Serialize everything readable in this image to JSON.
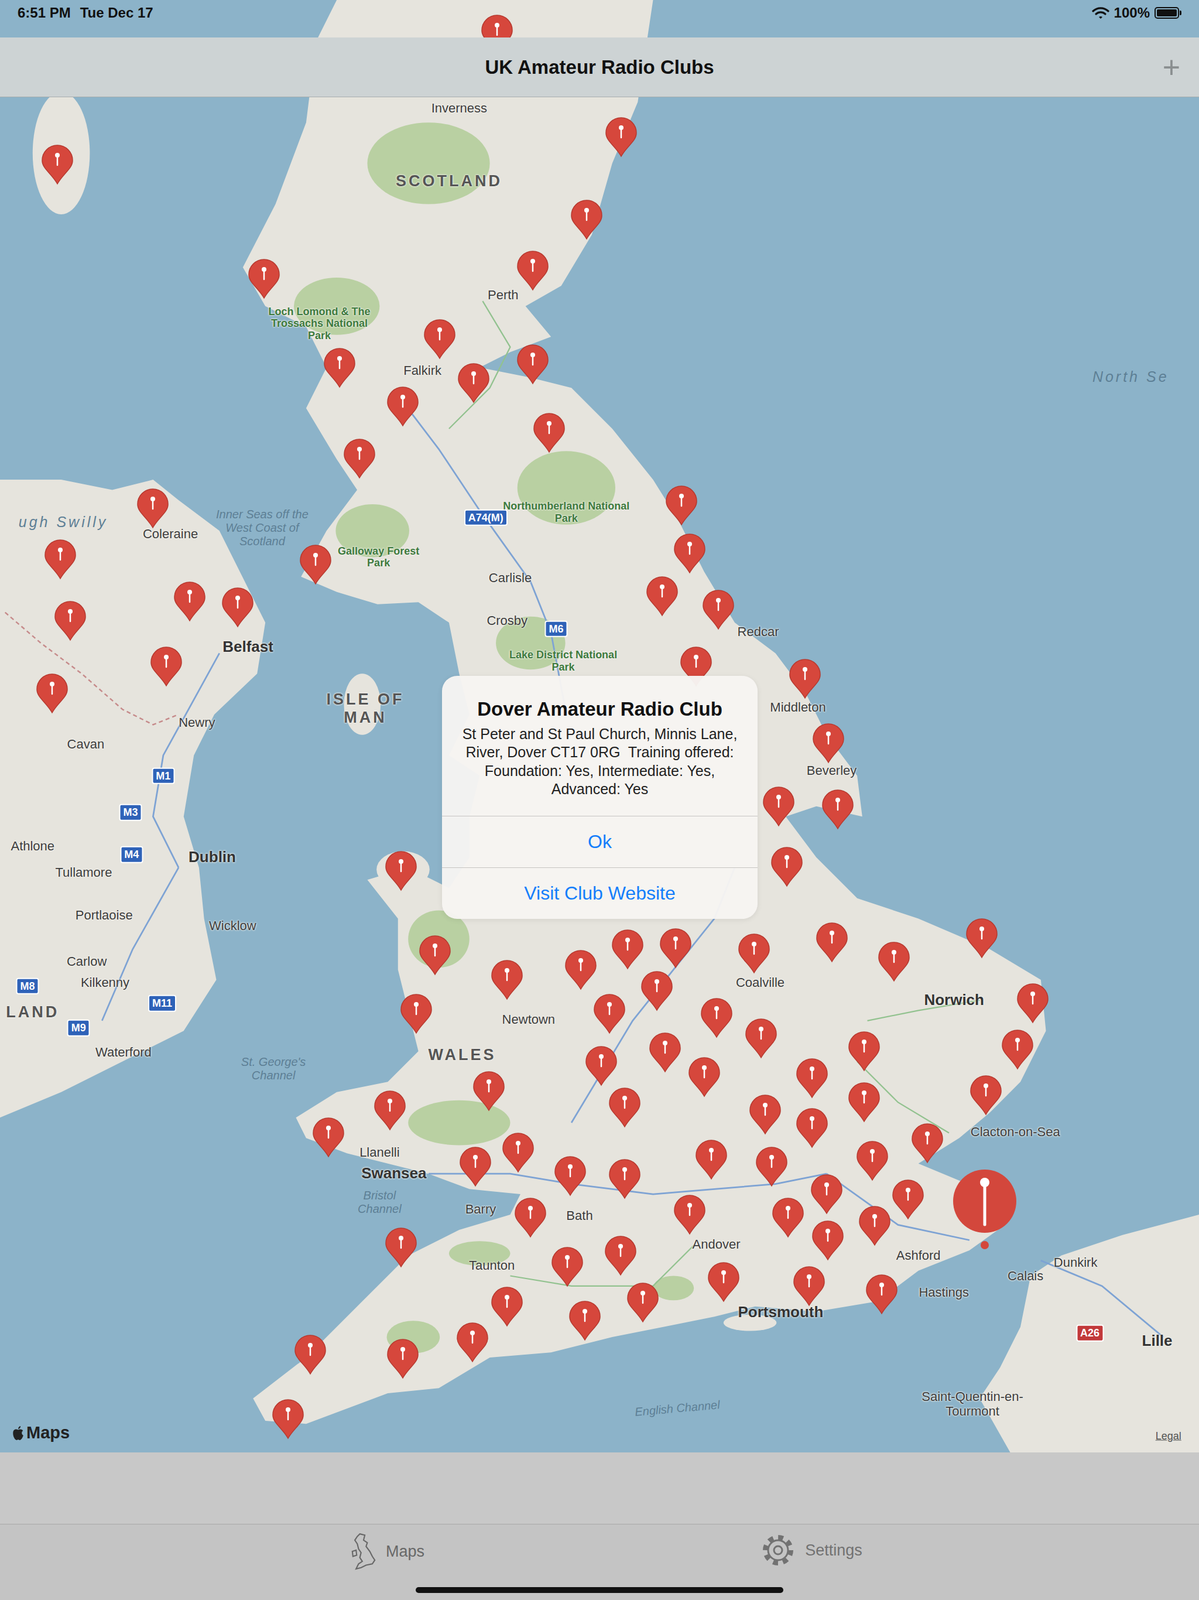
{
  "status_bar": {
    "time": "6:51 PM",
    "date": "Tue Dec 17",
    "battery": "100%",
    "battery_level": 1.0
  },
  "nav": {
    "title": "UK Amateur Radio Clubs",
    "add_button": "+"
  },
  "map": {
    "attribution": "Maps",
    "labels": [
      {
        "text": "Inverness",
        "kind": "town"
      },
      {
        "text": "SCOTLAND",
        "kind": "region"
      },
      {
        "text": "Loch Lomond & The Trossachs National Park",
        "kind": "park"
      },
      {
        "text": "Perth",
        "kind": "town"
      },
      {
        "text": "Falkirk",
        "kind": "town"
      },
      {
        "text": "North Se",
        "kind": "sea"
      },
      {
        "text": "Inner Seas off the West Coast of Scotland",
        "kind": "water"
      },
      {
        "text": "Northumberland National Park",
        "kind": "park"
      },
      {
        "text": "A74(M)",
        "kind": "motorway"
      },
      {
        "text": "Galloway Forest Park",
        "kind": "park"
      },
      {
        "text": "Carlisle",
        "kind": "town"
      },
      {
        "text": "Crosby",
        "kind": "town"
      },
      {
        "text": "M6",
        "kind": "motorway"
      },
      {
        "text": "Lake District National Park",
        "kind": "park"
      },
      {
        "text": "Redcar",
        "kind": "town"
      },
      {
        "text": "Middleton",
        "kind": "town"
      },
      {
        "text": "Beverley",
        "kind": "town"
      },
      {
        "text": "ISLE OF MAN",
        "kind": "region"
      },
      {
        "text": "ugh Swilly",
        "kind": "sea"
      },
      {
        "text": "Coleraine",
        "kind": "town"
      },
      {
        "text": "Belfast",
        "kind": "city"
      },
      {
        "text": "Newry",
        "kind": "town"
      },
      {
        "text": "Cavan",
        "kind": "town"
      },
      {
        "text": "M1",
        "kind": "motorway"
      },
      {
        "text": "M3",
        "kind": "motorway"
      },
      {
        "text": "Athlone",
        "kind": "town"
      },
      {
        "text": "M4",
        "kind": "motorway"
      },
      {
        "text": "Dublin",
        "kind": "city"
      },
      {
        "text": "Tullamore",
        "kind": "town"
      },
      {
        "text": "Portlaoise",
        "kind": "town"
      },
      {
        "text": "Wicklow",
        "kind": "town"
      },
      {
        "text": "Carlow",
        "kind": "town"
      },
      {
        "text": "M8",
        "kind": "motorway"
      },
      {
        "text": "Kilkenny",
        "kind": "town"
      },
      {
        "text": "M11",
        "kind": "motorway"
      },
      {
        "text": "LAND",
        "kind": "region"
      },
      {
        "text": "M9",
        "kind": "motorway"
      },
      {
        "text": "Waterford",
        "kind": "town"
      },
      {
        "text": "St. George's Channel",
        "kind": "water"
      },
      {
        "text": "Newtown",
        "kind": "town"
      },
      {
        "text": "Coalville",
        "kind": "town"
      },
      {
        "text": "WALES",
        "kind": "region"
      },
      {
        "text": "Norwich",
        "kind": "city"
      },
      {
        "text": "Clacton-on-Sea",
        "kind": "town"
      },
      {
        "text": "Llanelli",
        "kind": "town"
      },
      {
        "text": "Swansea",
        "kind": "city"
      },
      {
        "text": "Bristol Channel",
        "kind": "water"
      },
      {
        "text": "Barry",
        "kind": "town"
      },
      {
        "text": "Bath",
        "kind": "town"
      },
      {
        "text": "Andover",
        "kind": "town"
      },
      {
        "text": "Ashford",
        "kind": "town"
      },
      {
        "text": "Taunton",
        "kind": "town"
      },
      {
        "text": "Calais",
        "kind": "town"
      },
      {
        "text": "Dunkirk",
        "kind": "town"
      },
      {
        "text": "Hastings",
        "kind": "town"
      },
      {
        "text": "Portsmouth",
        "kind": "city"
      },
      {
        "text": "A26",
        "kind": "aroad"
      },
      {
        "text": "Lille",
        "kind": "city"
      },
      {
        "text": "Saint-Quentin-en-Tourmont",
        "kind": "town"
      },
      {
        "text": "English Channel",
        "kind": "water"
      },
      {
        "text": "Legal",
        "kind": "legal"
      }
    ],
    "pins": [
      {
        "selected": false
      },
      {
        "selected": false
      },
      {
        "selected": false
      },
      {
        "selected": false
      },
      {
        "selected": false
      },
      {
        "selected": false
      },
      {
        "selected": false
      },
      {
        "selected": false
      },
      {
        "selected": false
      },
      {
        "selected": false
      },
      {
        "selected": false
      },
      {
        "selected": false
      },
      {
        "selected": false
      },
      {
        "selected": false
      },
      {
        "selected": false
      },
      {
        "selected": false
      },
      {
        "selected": false
      },
      {
        "selected": false
      },
      {
        "selected": false
      },
      {
        "selected": false
      },
      {
        "selected": false
      },
      {
        "selected": false
      },
      {
        "selected": false
      },
      {
        "selected": false
      },
      {
        "selected": false
      },
      {
        "selected": false
      },
      {
        "selected": false
      },
      {
        "selected": false
      },
      {
        "selected": false
      },
      {
        "selected": false
      },
      {
        "selected": false
      },
      {
        "selected": false
      },
      {
        "selected": false
      },
      {
        "selected": false
      },
      {
        "selected": false
      },
      {
        "selected": false
      },
      {
        "selected": false
      },
      {
        "selected": false
      },
      {
        "selected": false
      },
      {
        "selected": false
      },
      {
        "selected": false
      },
      {
        "selected": false
      },
      {
        "selected": false
      },
      {
        "selected": false
      },
      {
        "selected": false
      },
      {
        "selected": false
      },
      {
        "selected": false
      },
      {
        "selected": false
      },
      {
        "selected": false
      },
      {
        "selected": false
      },
      {
        "selected": false
      },
      {
        "selected": false
      },
      {
        "selected": false
      },
      {
        "selected": false
      },
      {
        "selected": false
      },
      {
        "selected": false
      },
      {
        "selected": false
      },
      {
        "selected": false
      },
      {
        "selected": false
      },
      {
        "selected": false
      },
      {
        "selected": false
      },
      {
        "selected": false
      },
      {
        "selected": false
      },
      {
        "selected": false
      },
      {
        "selected": false
      },
      {
        "selected": false
      },
      {
        "selected": false
      },
      {
        "selected": false
      },
      {
        "selected": false
      },
      {
        "selected": false
      },
      {
        "selected": false
      },
      {
        "selected": false
      },
      {
        "selected": false
      },
      {
        "selected": false
      },
      {
        "selected": false
      },
      {
        "selected": false
      },
      {
        "selected": false
      },
      {
        "selected": false
      },
      {
        "selected": false
      },
      {
        "selected": false
      },
      {
        "selected": false
      },
      {
        "selected": false
      },
      {
        "selected": false
      },
      {
        "selected": false
      },
      {
        "selected": false
      },
      {
        "selected": false
      },
      {
        "selected": false
      },
      {
        "selected": false
      },
      {
        "selected": false
      },
      {
        "selected": true
      }
    ]
  },
  "dialog": {
    "title": "Dover Amateur Radio Club",
    "message": "St Peter and St Paul Church, Minnis Lane, River, Dover CT17 0RG  Training offered: Foundation: Yes, Intermediate: Yes, Advanced: Yes",
    "buttons": [
      "Ok",
      "Visit Club Website"
    ]
  },
  "tabs": [
    {
      "label": "Maps",
      "selected": true
    },
    {
      "label": "Settings",
      "selected": false
    }
  ]
}
